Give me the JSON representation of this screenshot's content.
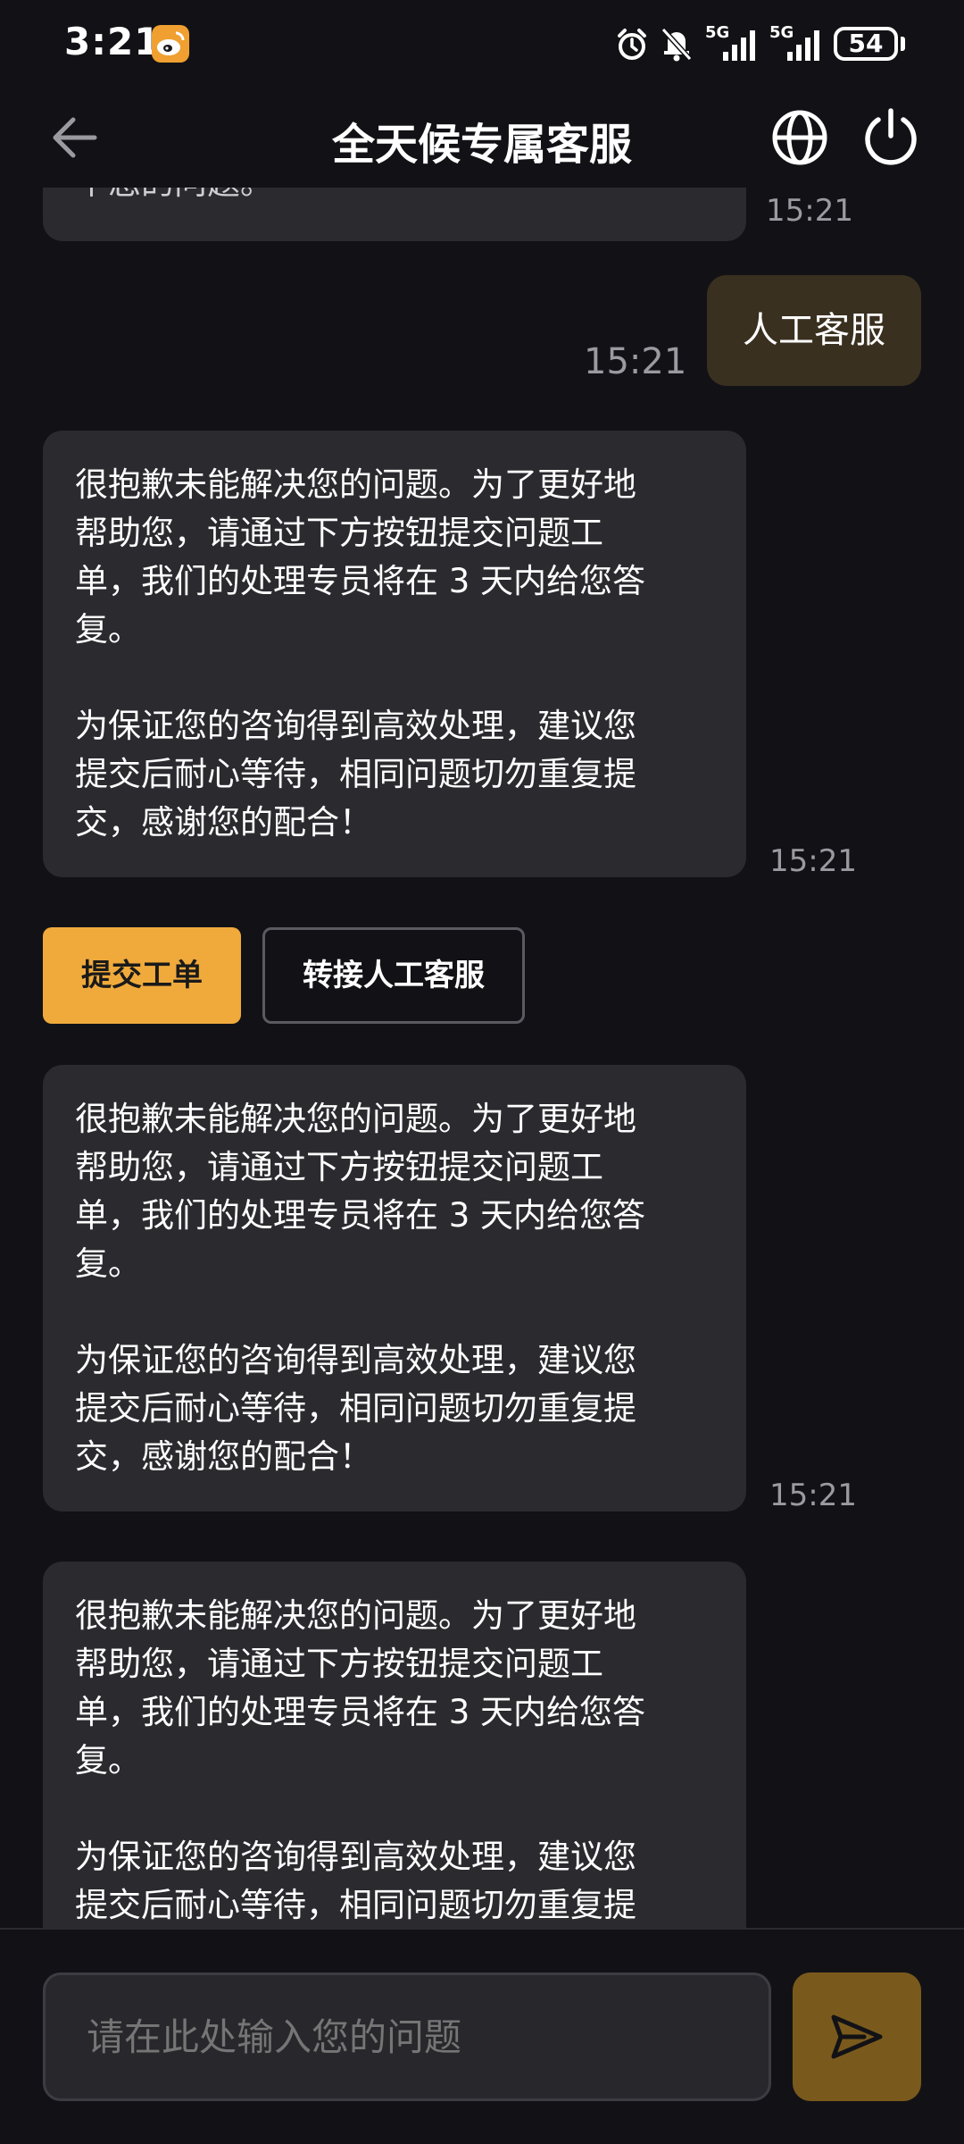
{
  "status_bar": {
    "time": "3:21",
    "net_a": "5G",
    "net_b": "5G",
    "battery": "54"
  },
  "header": {
    "title": "全天候专属客服",
    "back_icon": "arrow-left-icon",
    "globe_icon": "globe-icon",
    "power_icon": "power-icon"
  },
  "messages": [
    {
      "role": "bot",
      "partial_text": "个您的问题。",
      "time": "15:21"
    },
    {
      "role": "user",
      "text": "人工客服",
      "time": "15:21"
    },
    {
      "role": "bot",
      "lines_a": [
        "很抱歉未能解决您的问题。为了更好地",
        "帮助您，请通过下方按钮提交问题工",
        "单，我们的处理专员将在 3 天内给您答",
        "复。"
      ],
      "lines_b": [
        "为保证您的咨询得到高效处理，建议您",
        "提交后耐心等待，相同问题切勿重复提",
        "交，感谢您的配合！"
      ],
      "time": "15:21"
    },
    {
      "role": "bot",
      "lines_a": [
        "很抱歉未能解决您的问题。为了更好地",
        "帮助您，请通过下方按钮提交问题工",
        "单，我们的处理专员将在 3 天内给您答",
        "复。"
      ],
      "lines_b": [
        "为保证您的咨询得到高效处理，建议您",
        "提交后耐心等待，相同问题切勿重复提",
        "交，感谢您的配合！"
      ],
      "time": "15:21"
    },
    {
      "role": "bot",
      "lines_a": [
        "很抱歉未能解决您的问题。为了更好地",
        "帮助您，请通过下方按钮提交问题工",
        "单，我们的处理专员将在 3 天内给您答",
        "复。"
      ],
      "lines_b": [
        "为保证您的咨询得到高效处理，建议您",
        "提交后耐心等待，相同问题切勿重复提"
      ]
    }
  ],
  "actions": {
    "submit_ticket": "提交工单",
    "transfer_human": "转接人工客服"
  },
  "input": {
    "placeholder": "请在此处输入您的问题",
    "value": ""
  },
  "colors": {
    "background": "#121216",
    "bot_bubble": "#2a2a2f",
    "user_bubble": "#3a3020",
    "accent": "#f0aa3c",
    "send_button": "#7a5a1c"
  }
}
